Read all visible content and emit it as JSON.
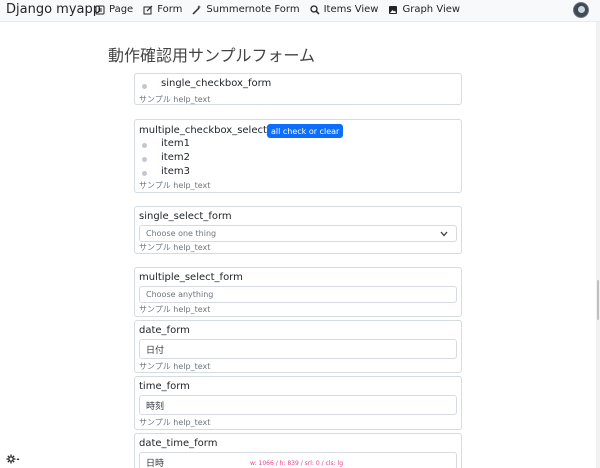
{
  "navbar": {
    "brand": "Django myapp",
    "items": [
      {
        "label": "Page",
        "icon": "page-icon"
      },
      {
        "label": "Form",
        "icon": "edit-icon"
      },
      {
        "label": "Summernote Form",
        "icon": "magic-wand-icon"
      },
      {
        "label": "Items View",
        "icon": "search-icon"
      },
      {
        "label": "Graph View",
        "icon": "image-icon"
      }
    ]
  },
  "page": {
    "title": "動作確認用サンプルフォーム"
  },
  "fields": {
    "single_checkbox": {
      "label": "single_checkbox_form",
      "help": "サンプル help_text"
    },
    "multiple_checkbox": {
      "label": "multiple_checkbox_select_form",
      "button": "all check or clear",
      "items": [
        "item1",
        "item2",
        "item3"
      ],
      "help": "サンプル help_text"
    },
    "single_select": {
      "label": "single_select_form",
      "placeholder": "Choose one thing",
      "help": "サンプル help_text"
    },
    "multiple_select": {
      "label": "multiple_select_form",
      "placeholder": "Choose anything",
      "help": "サンプル help_text"
    },
    "date": {
      "label": "date_form",
      "placeholder": "日付",
      "help": "サンプル help_text"
    },
    "time": {
      "label": "time_form",
      "placeholder": "時刻",
      "help": "サンプル help_text"
    },
    "date_time": {
      "label": "date_time_form",
      "placeholder": "日時"
    }
  },
  "debug": {
    "w": "w: 1066",
    "h": "h: 839",
    "srl": "srl: 0",
    "cls": "cls: lg"
  }
}
